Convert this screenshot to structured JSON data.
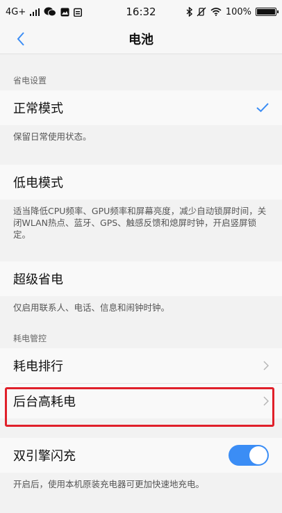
{
  "status_bar": {
    "network": "4G+",
    "time": "16:32",
    "battery_percent": "100%"
  },
  "nav": {
    "title": "电池"
  },
  "power_settings": {
    "header": "省电设置",
    "normal_mode": {
      "label": "正常模式",
      "desc": "保留日常使用状态。",
      "selected": true
    },
    "low_mode": {
      "label": "低电模式",
      "desc": "适当降低CPU频率、GPU频率和屏幕亮度，减少自动锁屏时间，关闭WLAN热点、蓝牙、GPS、触感反馈和熄屏时钟，开启竖屏锁定。"
    },
    "super_mode": {
      "label": "超级省电",
      "desc": "仅启用联系人、电话、信息和闹钟时钟。"
    }
  },
  "power_control": {
    "header": "耗电管控",
    "ranking_label": "耗电排行",
    "background_label": "后台高耗电"
  },
  "dual_engine": {
    "label": "双引擎闪充",
    "desc": "开启后，使用本机原装充电器可更加快速地充电。",
    "enabled": true
  },
  "colors": {
    "accent": "#3b8df5",
    "highlight": "#e0202a"
  }
}
